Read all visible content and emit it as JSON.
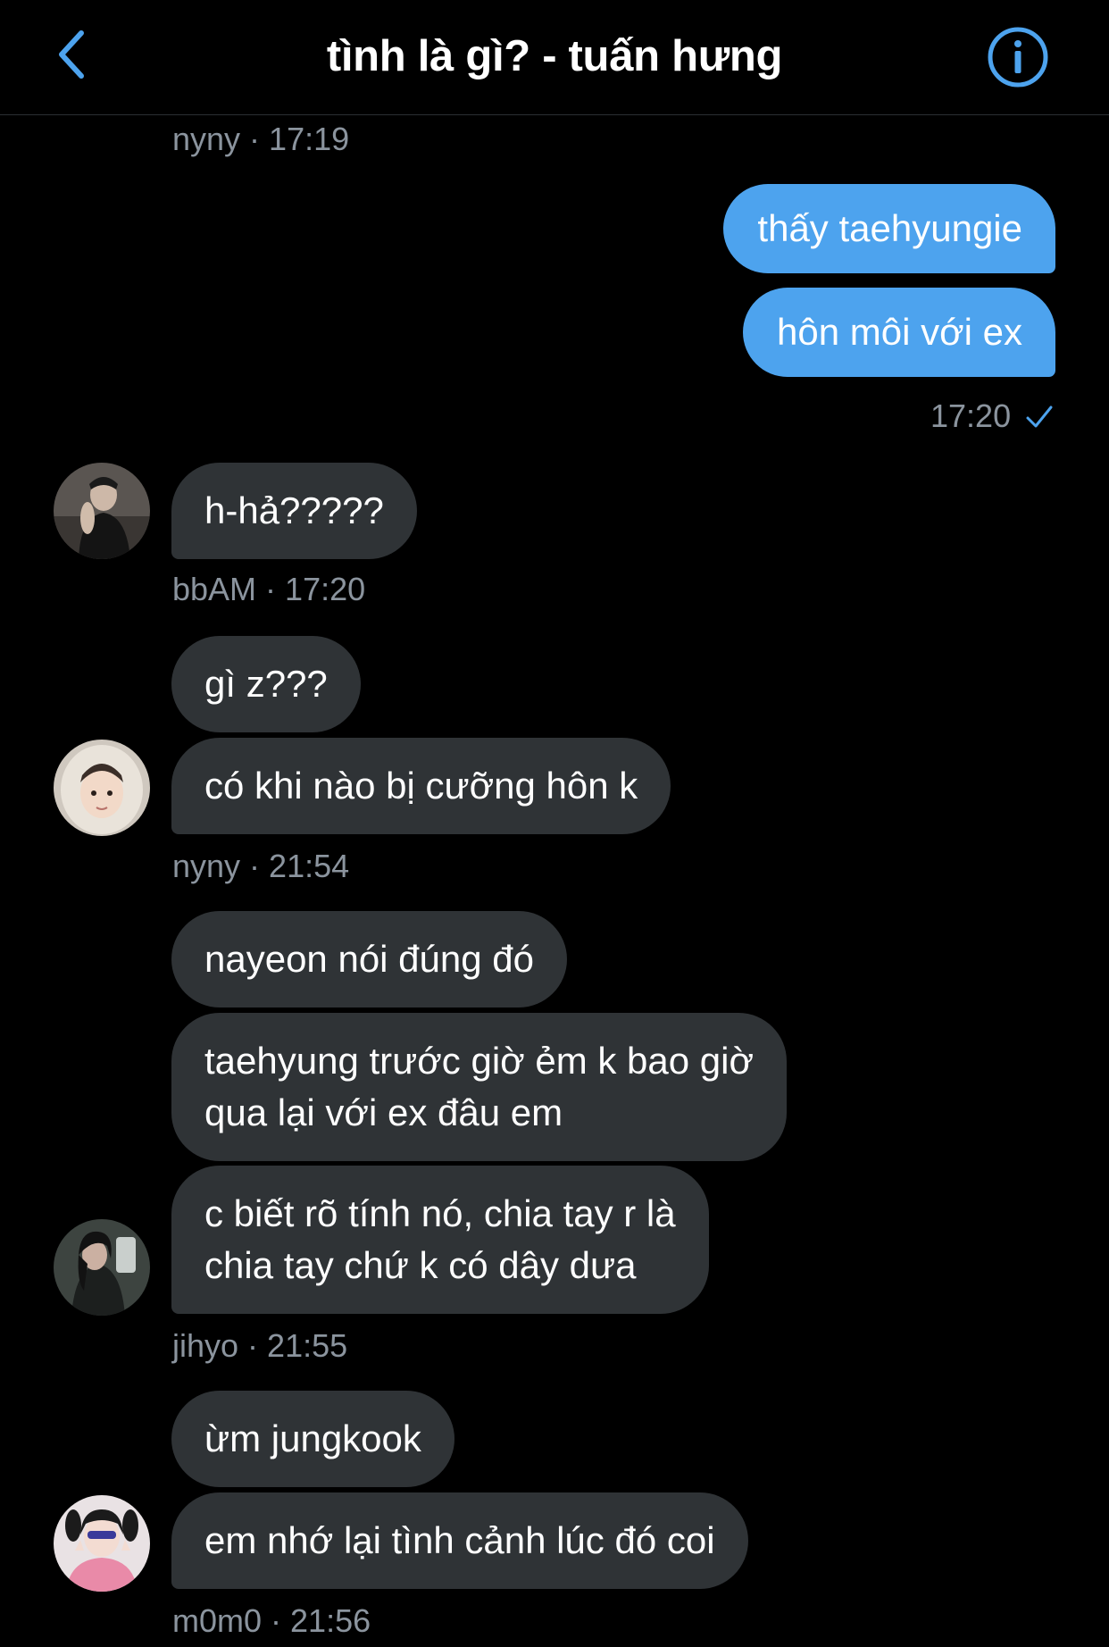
{
  "header": {
    "title": "tình là gì? - tuấn hưng",
    "back_icon": "chevron-left-icon",
    "info_icon": "info-circle-icon",
    "accent_color": "#4da3ee"
  },
  "messages": [
    {
      "type": "meta",
      "sender": "nyny",
      "time": "17:19"
    },
    {
      "type": "out",
      "text": "thấy taehyungie"
    },
    {
      "type": "out",
      "text": "hôn môi với ex"
    },
    {
      "type": "out-meta",
      "time": "17:20",
      "status_icon": "checkmark-icon"
    },
    {
      "type": "in",
      "text": "h-hả?????"
    },
    {
      "type": "meta",
      "sender": "bbAM",
      "time": "17:20"
    },
    {
      "type": "in",
      "text": "gì z???"
    },
    {
      "type": "in",
      "text": "có khi nào bị cưỡng hôn k"
    },
    {
      "type": "meta",
      "sender": "nyny",
      "time": "21:54"
    },
    {
      "type": "in",
      "text": "nayeon nói đúng đó"
    },
    {
      "type": "in",
      "lines": [
        "taehyung trước giờ ẻm k bao giờ",
        "qua lại với ex đâu em"
      ]
    },
    {
      "type": "in",
      "lines": [
        "c biết rõ tính nó, chia tay r là",
        "chia tay chứ k có dây dưa"
      ]
    },
    {
      "type": "meta",
      "sender": "jihyo",
      "time": "21:55"
    },
    {
      "type": "in",
      "text": "ừm jungkook"
    },
    {
      "type": "in",
      "text": "em nhớ lại tình cảnh lúc đó coi"
    },
    {
      "type": "meta",
      "sender": "m0m0",
      "time": "21:56"
    }
  ],
  "meta_separator": " · ",
  "colors": {
    "incoming_bubble": "#2f3336",
    "outgoing_bubble": "#4da3ee",
    "meta_text": "#8b949e",
    "background": "#000000"
  }
}
